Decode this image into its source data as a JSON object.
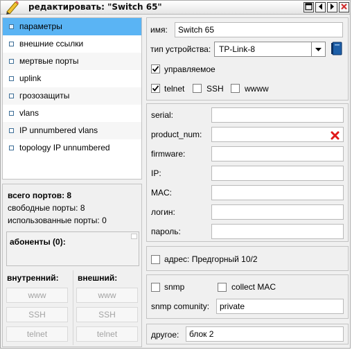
{
  "window": {
    "title": "редактировать: \"Switch 65\""
  },
  "sidebar": {
    "items": [
      {
        "label": "параметры"
      },
      {
        "label": "внешние ссылки"
      },
      {
        "label": "мертвые порты"
      },
      {
        "label": "uplink"
      },
      {
        "label": "грозозащиты"
      },
      {
        "label": "vlans"
      },
      {
        "label": "IP unnumbered vlans"
      },
      {
        "label": "topology IP unnumbered"
      }
    ]
  },
  "stats": {
    "total_ports": "всего портов: 8",
    "free_ports": "свободные порты: 8",
    "used_ports": "использованные порты: 0",
    "subscribers": "абоненты (0):",
    "internal_label": "внутренний:",
    "external_label": "внешний:",
    "internal_buttons": [
      "www",
      "SSH",
      "telnet"
    ],
    "external_buttons": [
      "www",
      "SSH",
      "telnet"
    ]
  },
  "device": {
    "name_label": "имя:",
    "name_value": "Switch 65",
    "type_label": "тип устройства:",
    "type_value": "TP-Link-8",
    "managed_label": "управляемое",
    "managed_checked": true,
    "telnet_label": "telnet",
    "telnet_checked": true,
    "ssh_label": "SSH",
    "ssh_checked": false,
    "www_label": "wwww",
    "www_checked": false
  },
  "details": {
    "serial_label": "serial:",
    "product_label": "product_num:",
    "firmware_label": "firmware:",
    "ip_label": "IP:",
    "mac_label": "MAC:",
    "login_label": "логин:",
    "password_label": "пароль:"
  },
  "address": {
    "label": "адрес: Предгорный 10/2",
    "checked": false
  },
  "snmp": {
    "snmp_label": "snmp",
    "snmp_checked": false,
    "collect_mac_label": "collect MAC",
    "collect_mac_checked": false,
    "community_label": "snmp comunity:",
    "community_value": "private"
  },
  "other": {
    "label": "другое:",
    "value": "блок 2"
  },
  "colors": {
    "selected": "#5ab4f4",
    "close_red": "#d12b2b",
    "clear_icon": "#e01818"
  },
  "icons": [
    "pencil-icon",
    "maximize-icon",
    "prev-icon",
    "next-icon",
    "close-icon",
    "clear-icon",
    "book-icon",
    "chevron-down-icon",
    "checkmark-icon"
  ]
}
